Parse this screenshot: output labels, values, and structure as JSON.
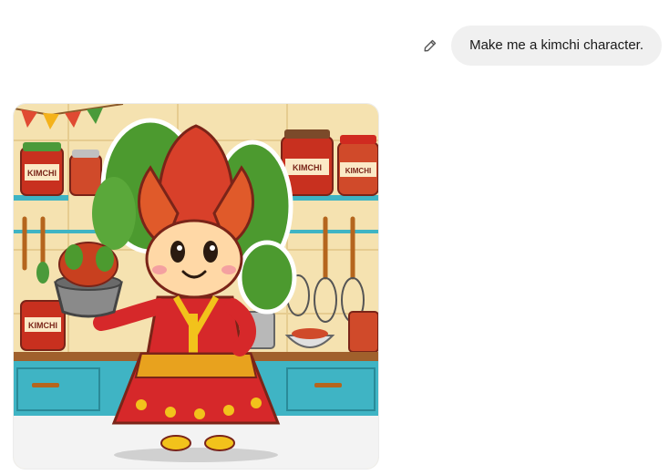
{
  "conversation": {
    "user_message": "Make me a kimchi character.",
    "edit_icon": "pencil-icon"
  },
  "generated_image": {
    "jar_label": "KIMCHI",
    "colors": {
      "wall": "#f5e2b0",
      "tile_line": "#e6cc90",
      "counter": "#3fb4c4",
      "kimchi_red": "#d8402a",
      "cabbage_green": "#4c9a2f",
      "hanbok_red": "#d6282a",
      "collar_yellow": "#f2c21b"
    }
  }
}
